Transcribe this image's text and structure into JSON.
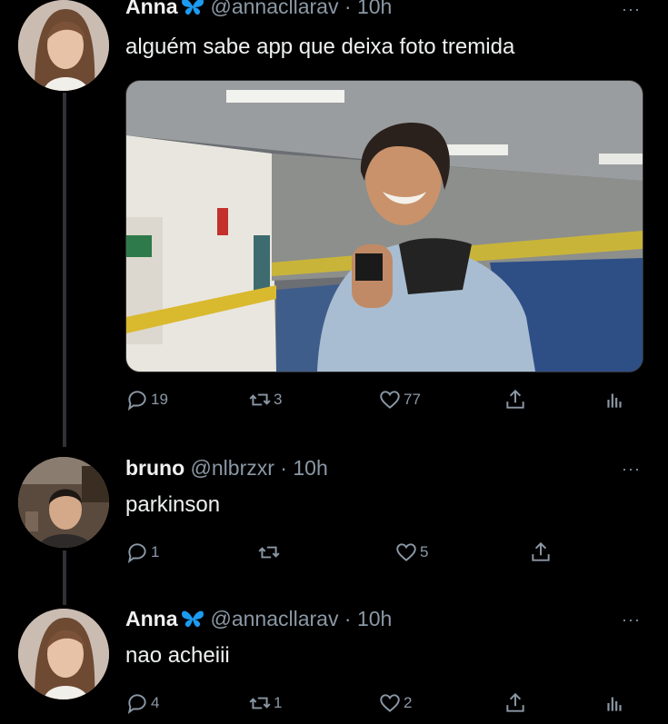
{
  "tweets": [
    {
      "name": "Anna",
      "handle": "@annacllarav",
      "separator": "·",
      "time": "10h",
      "more": "···",
      "text": "alguém sabe app que deixa foto tremida",
      "has_media": true,
      "replies": "19",
      "retweets": "3",
      "likes": "77",
      "avatar_icon": "woman-portrait-avatar",
      "verified_icon": "butterfly-icon"
    },
    {
      "name": "bruno",
      "handle": "@nlbrzxr",
      "separator": "·",
      "time": "10h",
      "more": "···",
      "text": "parkinson",
      "has_media": false,
      "replies": "1",
      "retweets": "",
      "likes": "5",
      "avatar_icon": "man-portrait-avatar"
    },
    {
      "name": "Anna",
      "handle": "@annacllarav",
      "separator": "·",
      "time": "10h",
      "more": "···",
      "text": "nao acheiii",
      "has_media": false,
      "replies": "4",
      "retweets": "1",
      "likes": "2",
      "avatar_icon": "woman-portrait-avatar",
      "verified_icon": "butterfly-icon"
    }
  ],
  "colors": {
    "background": "#000000",
    "text": "#e7e9ea",
    "muted": "#8b98a5",
    "verified_blue": "#1d9bf0"
  }
}
